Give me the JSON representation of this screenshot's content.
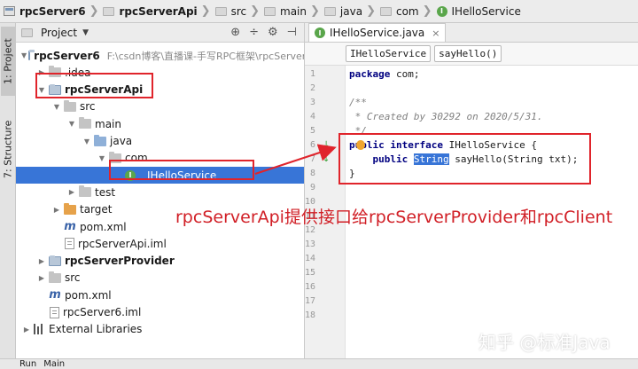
{
  "breadcrumb": {
    "items": [
      {
        "label": "rpcServer6",
        "icon": "project-icon",
        "bold": true
      },
      {
        "label": "rpcServerApi",
        "icon": "module-folder-icon",
        "bold": true
      },
      {
        "label": "src",
        "icon": "folder-icon",
        "bold": false
      },
      {
        "label": "main",
        "icon": "folder-icon",
        "bold": false
      },
      {
        "label": "java",
        "icon": "folder-icon",
        "bold": false
      },
      {
        "label": "com",
        "icon": "folder-icon",
        "bold": false
      },
      {
        "label": "IHelloService",
        "icon": "interface-icon",
        "bold": false
      }
    ]
  },
  "side_tabs": {
    "project": "1: Project",
    "structure": "7: Structure"
  },
  "project_panel": {
    "title": "Project",
    "tree": [
      {
        "label": "rpcServer6",
        "extra": "F:\\csdn博客\\直播课-手写RPC框架\\rpcServer",
        "indent": 0,
        "arrow": "open",
        "icon": "module",
        "bold": true
      },
      {
        "label": ".idea",
        "extra": "",
        "indent": 1,
        "arrow": "closed",
        "icon": "folder",
        "bold": false
      },
      {
        "label": "rpcServerApi",
        "extra": "",
        "indent": 1,
        "arrow": "open",
        "icon": "module",
        "bold": true
      },
      {
        "label": "src",
        "extra": "",
        "indent": 2,
        "arrow": "open",
        "icon": "folder",
        "bold": false
      },
      {
        "label": "main",
        "extra": "",
        "indent": 3,
        "arrow": "open",
        "icon": "folder",
        "bold": false
      },
      {
        "label": "java",
        "extra": "",
        "indent": 4,
        "arrow": "open",
        "icon": "blue",
        "bold": false
      },
      {
        "label": "com",
        "extra": "",
        "indent": 5,
        "arrow": "open",
        "icon": "folder",
        "bold": false
      },
      {
        "label": "IHelloService",
        "extra": "",
        "indent": 6,
        "arrow": "none",
        "icon": "interface",
        "bold": false,
        "selected": true
      },
      {
        "label": "test",
        "extra": "",
        "indent": 3,
        "arrow": "closed",
        "icon": "folder",
        "bold": false
      },
      {
        "label": "target",
        "extra": "",
        "indent": 2,
        "arrow": "closed",
        "icon": "orange",
        "bold": false
      },
      {
        "label": "pom.xml",
        "extra": "",
        "indent": 2,
        "arrow": "none",
        "icon": "maven",
        "bold": false
      },
      {
        "label": "rpcServerApi.iml",
        "extra": "",
        "indent": 2,
        "arrow": "none",
        "icon": "file",
        "bold": false
      },
      {
        "label": "rpcServerProvider",
        "extra": "",
        "indent": 1,
        "arrow": "closed",
        "icon": "module",
        "bold": true
      },
      {
        "label": "src",
        "extra": "",
        "indent": 1,
        "arrow": "closed",
        "icon": "folder",
        "bold": false
      },
      {
        "label": "pom.xml",
        "extra": "",
        "indent": 1,
        "arrow": "none",
        "icon": "maven",
        "bold": false
      },
      {
        "label": "rpcServer6.iml",
        "extra": "",
        "indent": 1,
        "arrow": "none",
        "icon": "file",
        "bold": false
      },
      {
        "label": "External Libraries",
        "extra": "",
        "indent": 0,
        "arrow": "closed",
        "icon": "library",
        "bold": false
      }
    ]
  },
  "editor": {
    "tab_label": "IHelloService.java",
    "crumbs": [
      "IHelloService",
      "sayHello()"
    ],
    "line_numbers": [
      "1",
      "2",
      "3",
      "4",
      "5",
      "6",
      "7",
      "8",
      "9",
      "10",
      "11",
      "12",
      "13",
      "14",
      "15",
      "16",
      "17",
      "18"
    ],
    "code": {
      "l1_kw": "package",
      "l1_rest": " com;",
      "l3": "/**",
      "l4": " * Created by 30292 on 2020/5/31.",
      "l5": " */",
      "l6_a": "public",
      "l6_b": " interface",
      "l6_c": " IHelloService {",
      "l7_a": "    public ",
      "l7_b": "String",
      "l7_c": " sayHello(",
      "l7_d": "String",
      "l7_e": " txt);",
      "l8": "}"
    }
  },
  "annotation": {
    "caption": "rpcServerApi提供接口给rpcServerProvider和rpcClient",
    "watermark": "知乎 @标准Java",
    "color": "#e0242b"
  },
  "bottom_bar": {
    "run_label": "Run",
    "main_label": "Main"
  }
}
